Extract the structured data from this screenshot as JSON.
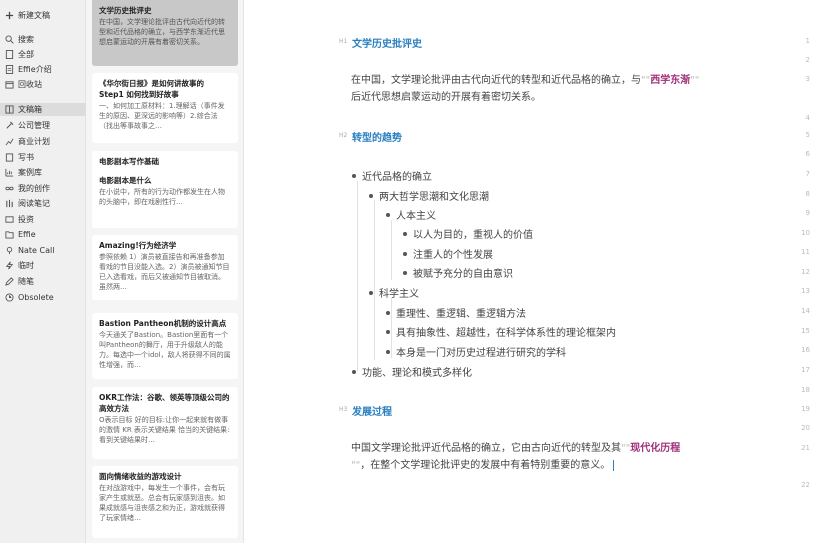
{
  "sidebar": {
    "items": [
      {
        "icon": "plus-icon",
        "label": "新建文稿"
      },
      {
        "icon": "search-icon",
        "label": "搜索"
      },
      {
        "icon": "document-icon",
        "label": "全部"
      },
      {
        "icon": "document-icon",
        "label": "Effie介绍"
      },
      {
        "icon": "trash-icon",
        "label": "回收站"
      },
      {
        "icon": "book-icon",
        "label": "文稿箱"
      },
      {
        "icon": "wrench-icon",
        "label": "公司管理"
      },
      {
        "icon": "chart-icon",
        "label": "商业计划"
      },
      {
        "icon": "book-icon",
        "label": "写书"
      },
      {
        "icon": "chart-icon",
        "label": "案例库"
      },
      {
        "icon": "infinity-icon",
        "label": "我的创作"
      },
      {
        "icon": "columns-icon",
        "label": "阅读笔记"
      },
      {
        "icon": "dollar-icon",
        "label": "投资"
      },
      {
        "icon": "folder-icon",
        "label": "Effie"
      },
      {
        "icon": "phone-icon",
        "label": "Nate Call"
      },
      {
        "icon": "lightning-icon",
        "label": "临时"
      },
      {
        "icon": "pencil-icon",
        "label": "随笔"
      },
      {
        "icon": "clock-icon",
        "label": "Obsolete"
      }
    ]
  },
  "notes": [
    {
      "title": "文学历史批评史",
      "body": "在中国，文学理论批评由古代向近代的转型和近代品格的确立，与西学东渐近代思想启蒙运动的开展有着密切关系。",
      "sub": "",
      "sub_body": ""
    },
    {
      "title": "《华尔街日报》是如何讲故事的 Step1  如何找到好故事",
      "body": "一、如何加工原材料：1.理解话（事件发生的原因、更深远的影响等）2.综合法（找出等事故事之…",
      "sub": "",
      "sub_body": ""
    },
    {
      "title": "电影剧本写作基础",
      "body": "",
      "sub": "电影剧本是什么",
      "sub_body": "在小说中，所有的行为动作都发生在人物的头脑中，即在戏剧性行…"
    },
    {
      "title": "Amazing!行为经济学",
      "body": "参照依赖 1）演员被直接告和再准备参加看戏的节目没能入选。2）演员被通知节目已入选看戏，而后又被通知节目被取消。虽然两…",
      "sub": "",
      "sub_body": ""
    },
    {
      "title": "Bastion Pantheon机制的设计高点",
      "body": "今天通关了Bastion。Bastion里面有一个叫Pantheon的舞厅，用于升级敌人的能力。每选中一个idol，敌人将获得不同的属性增强，而…",
      "sub": "",
      "sub_body": ""
    },
    {
      "title": "OKR工作法：谷歌、领英等顶级公司的高效方法",
      "body": "O表示目标 好的目标:让你一起来就有做事的激情 KR 表示关键结果 恰当的关键结果:看到关键结果时…",
      "sub": "",
      "sub_body": ""
    },
    {
      "title": "面向情绪收益的游戏设计",
      "body": "在对战游戏中，每发生一个事件，会有玩家产生或就恶。总会有玩家感到沮丧。如果成就感与沮丧感之和为正，游戏就获得了玩家情绪…",
      "sub": "",
      "sub_body": ""
    }
  ],
  "editor": {
    "h1_tag": "H1",
    "h1": "文学历史批评史",
    "para1_a": "在中国，文学理论批评由古代向近代的转型和近代品格的确立，与",
    "para1_q1": "\"\"",
    "para1_hl": "西学东渐",
    "para1_q2": "\"\"",
    "para1_b": "后近代思想启蒙运动的开展有着密切关系。",
    "h2_tag": "H2",
    "h2": "转型的趋势",
    "bullets": [
      "近代品格的确立",
      "两大哲学思潮和文化思潮",
      "人本主义",
      "以人为目的，重视人的价值",
      "注重人的个性发展",
      "被赋予充分的自由意识",
      "科学主义",
      "重理性、重逻辑、重逻辑方法",
      "具有抽象性、超越性，在科学体系性的理论框架内",
      "本身是一门对历史过程进行研究的学科",
      "功能、理论和模式多样化"
    ],
    "h3_tag": "H3",
    "h3": "发展过程",
    "para2_a": "中国文学理论批评近代品格的确立，它由古向近代的转型及其",
    "para2_q1": "\"\"",
    "para2_hl": "现代化历程",
    "para2_q2": "\"\"",
    "para2_b": "，在整个文学理论批评史的发展中有着特别重要的意义。",
    "line_numbers": [
      "1",
      "2",
      "3",
      "4",
      "5",
      "6",
      "7",
      "8",
      "9",
      "10",
      "11",
      "12",
      "13",
      "14",
      "15",
      "16",
      "17",
      "18",
      "19",
      "20",
      "21",
      "22"
    ]
  },
  "colors": {
    "heading": "#2a7fc0",
    "highlight": "#a0307a"
  }
}
